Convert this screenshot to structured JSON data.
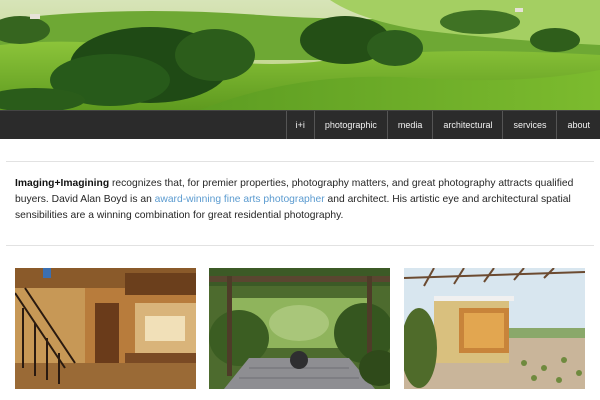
{
  "header": {
    "banner": "rolling-green-hills-photo",
    "nav": [
      {
        "label": "i+i"
      },
      {
        "label": "photographic"
      },
      {
        "label": "media"
      },
      {
        "label": "architectural"
      },
      {
        "label": "services"
      },
      {
        "label": "about"
      }
    ]
  },
  "intro": {
    "brand": "Imaging+Imagining",
    "text_1": " recognizes that, for premier properties, photography matters, and great photography attracts qualified buyers. David Alan Boyd is an ",
    "link_text": "award-winning fine arts photographer",
    "text_2": " and architect. His artistic eye and architectural spatial sensibilities are a winning combination for great residential photography."
  },
  "gallery": [
    {
      "subject": "interior-staircase-living-room"
    },
    {
      "subject": "garden-pergola-patio"
    },
    {
      "subject": "modern-house-with-trellis"
    }
  ],
  "colors": {
    "nav_background": "#2b2b2b",
    "nav_text": "#f2f2f2",
    "link": "#5b9bd0",
    "body_text": "#262626"
  }
}
